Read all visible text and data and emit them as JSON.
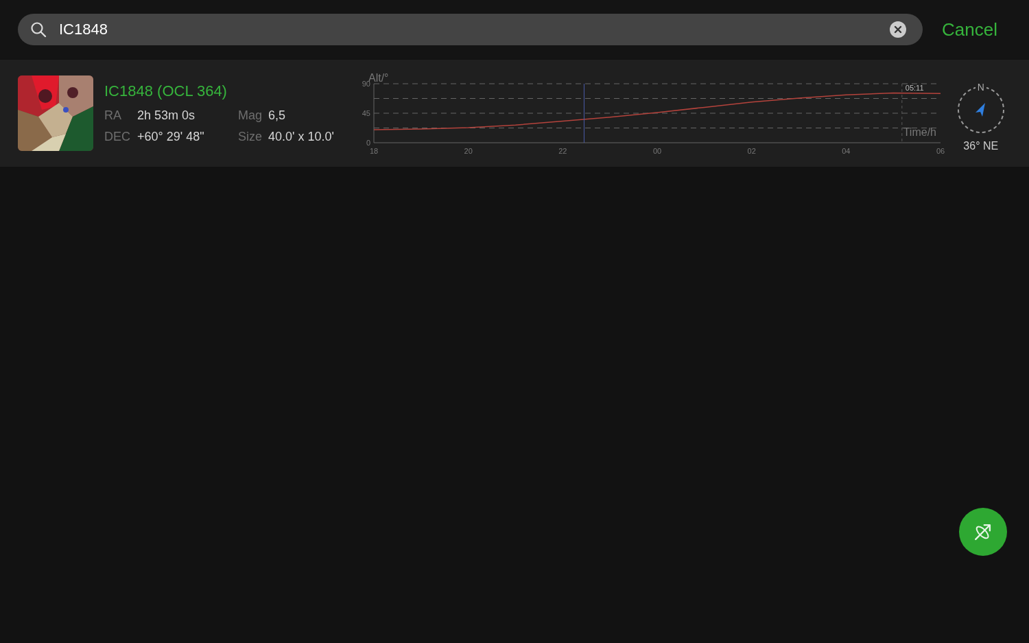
{
  "search": {
    "value": "IC1848",
    "cancel": "Cancel"
  },
  "results": [
    {
      "kind": "picture",
      "name": "IC1848 (OCL 364)",
      "fields": [
        {
          "label": "RA",
          "value": "2h 53m 0s"
        },
        {
          "label": "Mag",
          "value": "6,5"
        },
        {
          "label": "DEC",
          "value": "+60° 29' 48\""
        },
        {
          "label": "Size",
          "value": "40.0' x 10.0'"
        }
      ],
      "chart_data": {
        "type": "line",
        "xlabel": "Time/h",
        "ylabel": "Alt/°",
        "categories": [
          "18",
          null,
          "20",
          null,
          "22",
          null,
          "00",
          null,
          "02",
          null,
          "04",
          null,
          "06"
        ],
        "series": [
          {
            "color": "#b5433c",
            "values": [
              20,
              21,
              23,
              27,
              33,
              39,
              46,
              54,
              62,
              68,
              73,
              76,
              75
            ]
          }
        ],
        "ylim": [
          0,
          90
        ],
        "yticks": [
          0,
          45,
          90
        ],
        "annotations": [
          {
            "text": "05:11"
          }
        ]
      },
      "direction": "36° NE",
      "compass_mark": "N"
    }
  ]
}
